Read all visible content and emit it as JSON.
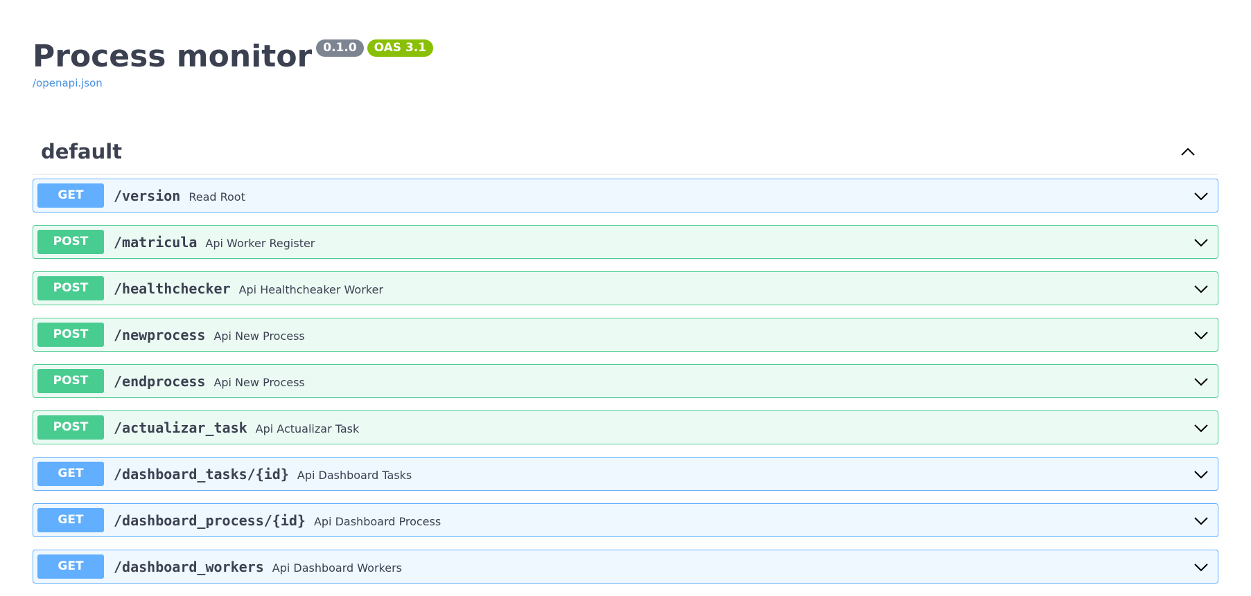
{
  "info": {
    "title": "Process monitor",
    "version_badge": "0.1.0",
    "oas_badge": "OAS 3.1",
    "spec_link": "/openapi.json"
  },
  "tag": {
    "name": "default",
    "expanded": true
  },
  "operations": [
    {
      "method": "GET",
      "path": "/version",
      "summary": "Read Root"
    },
    {
      "method": "POST",
      "path": "/matricula",
      "summary": "Api Worker Register"
    },
    {
      "method": "POST",
      "path": "/healthchecker",
      "summary": "Api Healthcheaker Worker"
    },
    {
      "method": "POST",
      "path": "/newprocess",
      "summary": "Api New Process"
    },
    {
      "method": "POST",
      "path": "/endprocess",
      "summary": "Api New Process"
    },
    {
      "method": "POST",
      "path": "/actualizar_task",
      "summary": "Api Actualizar Task"
    },
    {
      "method": "GET",
      "path": "/dashboard_tasks/{id}",
      "summary": "Api Dashboard Tasks"
    },
    {
      "method": "GET",
      "path": "/dashboard_process/{id}",
      "summary": "Api Dashboard Process"
    },
    {
      "method": "GET",
      "path": "/dashboard_workers",
      "summary": "Api Dashboard Workers"
    }
  ],
  "colors": {
    "get": "#61affe",
    "post": "#49cc90",
    "text": "#3b4151",
    "link": "#4990e2",
    "version_badge": "#7d8492",
    "oas_badge": "#89bf04"
  },
  "icons": {
    "tag_toggle": "chevron-up-icon",
    "operation_toggle": "chevron-down-icon"
  }
}
